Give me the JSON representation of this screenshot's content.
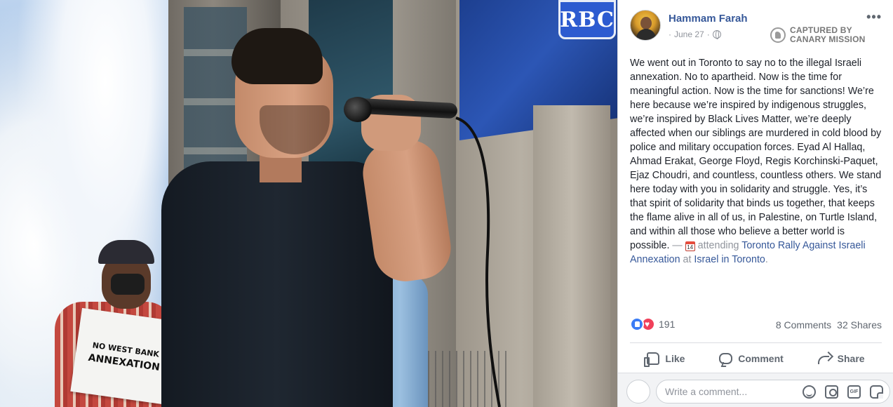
{
  "photo": {
    "sign_text": "RBC",
    "placard_lines": [
      "NO WEST BANK",
      "ANNEXATION"
    ]
  },
  "post": {
    "author": "Hammam Farah",
    "date": "June 27",
    "separator": "·",
    "visibility_icon": "globe-icon",
    "more_label": "•••",
    "capture_label_line1": "CAPTURED BY",
    "capture_label_line2": "CANARY MISSION",
    "body": "We went out in Toronto to say no to the illegal Israeli annexation. No to apartheid. Now is the time for meaningful action. Now is the time for sanctions! We’re here because we’re inspired by indigenous struggles, we’re inspired by Black Lives Matter, we’re deeply affected when our siblings are murdered in cold blood by police and military occupation forces. Eyad Al Hallaq, Ahmad Erakat, George Floyd, Regis Korchinski-Paquet, Ejaz Choudri, and countless, countless others. We stand here today with you in solidarity and struggle. Yes, it’s that spirit of solidarity that binds us together, that keeps the flame alive in all of us, in Palestine, on Turtle Island, and within all those who believe a better world is possible.",
    "dash": " — ",
    "calendar_day": "14",
    "attending": " attending ",
    "event_link": "Toronto Rally Against Israeli Annexation",
    "at": " at ",
    "place_link": "Israel in Toronto",
    "period": "."
  },
  "stats": {
    "reaction_count": "191",
    "comments": "8 Comments",
    "shares": "32 Shares"
  },
  "actions": {
    "like": "Like",
    "comment": "Comment",
    "share": "Share"
  },
  "comment_box": {
    "placeholder": "Write a comment...",
    "gif_label": "GIF"
  },
  "colors": {
    "link": "#365899",
    "muted": "#90949c",
    "like_blue": "#3b7cf5",
    "love_red": "#f0405a"
  }
}
